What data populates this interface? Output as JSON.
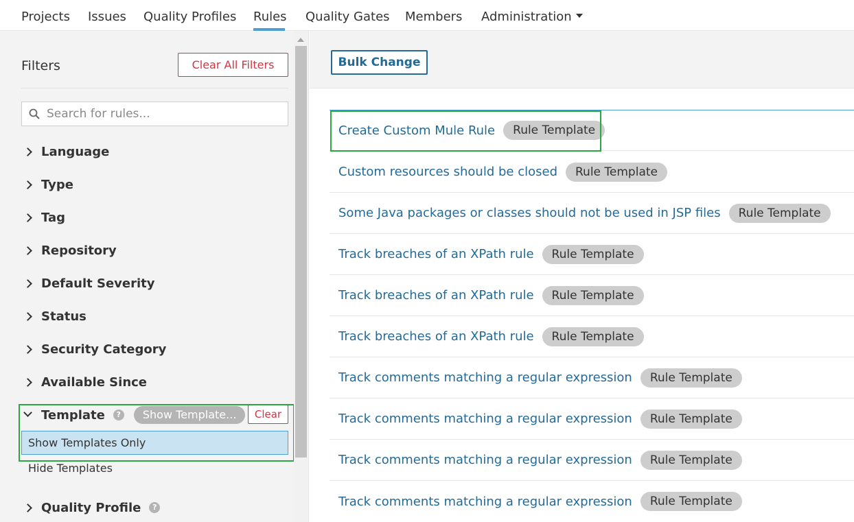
{
  "nav": {
    "items": [
      "Projects",
      "Issues",
      "Quality Profiles",
      "Rules",
      "Quality Gates",
      "Members",
      "Administration"
    ],
    "active": "Rules"
  },
  "sidebar": {
    "title": "Filters",
    "clear_all_label": "Clear All Filters",
    "search_placeholder": "Search for rules...",
    "facets": [
      "Language",
      "Type",
      "Tag",
      "Repository",
      "Default Severity",
      "Status",
      "Security Category",
      "Available Since"
    ],
    "template_facet": {
      "label": "Template",
      "badge": "Show Template...",
      "clear_label": "Clear",
      "options": [
        "Show Templates Only",
        "Hide Templates"
      ],
      "selected": "Show Templates Only"
    },
    "quality_profile_label": "Quality Profile"
  },
  "toolbar": {
    "bulk_change_label": "Bulk Change"
  },
  "rules": [
    {
      "name": "Create Custom Mule Rule",
      "badge": "Rule Template"
    },
    {
      "name": "Custom resources should be closed",
      "badge": "Rule Template"
    },
    {
      "name": "Some Java packages or classes should not be used in JSP files",
      "badge": "Rule Template"
    },
    {
      "name": "Track breaches of an XPath rule",
      "badge": "Rule Template"
    },
    {
      "name": "Track breaches of an XPath rule",
      "badge": "Rule Template"
    },
    {
      "name": "Track breaches of an XPath rule",
      "badge": "Rule Template"
    },
    {
      "name": "Track comments matching a regular expression",
      "badge": "Rule Template"
    },
    {
      "name": "Track comments matching a regular expression",
      "badge": "Rule Template"
    },
    {
      "name": "Track comments matching a regular expression",
      "badge": "Rule Template"
    },
    {
      "name": "Track comments matching a regular expression",
      "badge": "Rule Template"
    }
  ],
  "colors": {
    "link": "#236a97",
    "accent": "#4b9fd5",
    "danger": "#d4333f",
    "highlight": "#28a745"
  }
}
